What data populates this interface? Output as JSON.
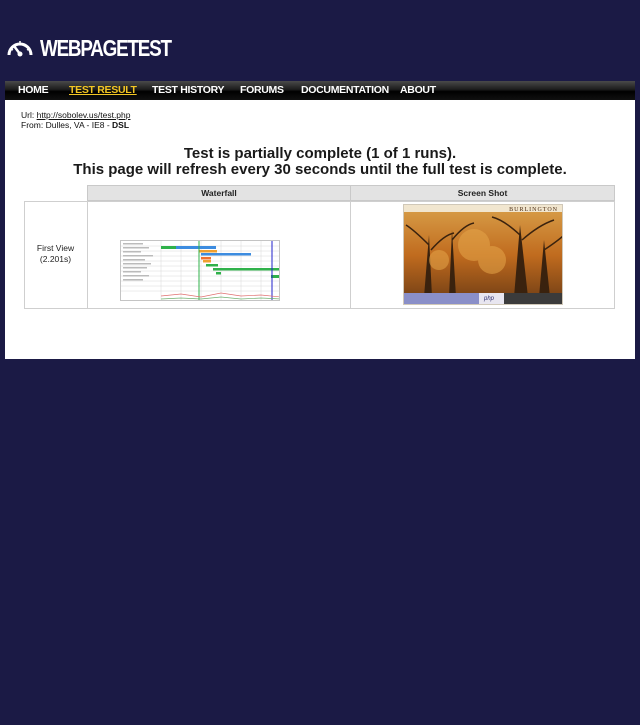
{
  "brand": {
    "bold": "WEB",
    "rest": "PAGETEST"
  },
  "nav": {
    "items": [
      {
        "label": "HOME",
        "active": false
      },
      {
        "label": "TEST RESULT",
        "active": true
      },
      {
        "label": "TEST HISTORY",
        "active": false
      },
      {
        "label": "FORUMS",
        "active": false
      },
      {
        "label": "DOCUMENTATION",
        "active": false
      },
      {
        "label": "ABOUT",
        "active": false
      }
    ]
  },
  "test": {
    "url_label": "Url:",
    "url": "http://sobolev.us/test.php",
    "from_label": "From:",
    "from_location": "Dulles, VA - IE8 -",
    "connection": "DSL"
  },
  "status": {
    "line1": "Test is partially complete (1 of 1 runs).",
    "line2": "This page will refresh every 30 seconds until the full test is complete."
  },
  "results": {
    "headers": {
      "waterfall": "Waterfall",
      "screenshot": "Screen Shot"
    },
    "row_label": "First View",
    "row_time": "(2.201s)"
  },
  "screenshot_thumb": {
    "brand": "BURLINGTON",
    "logo_text": "php"
  },
  "colors": {
    "page_bg": "#1b1a45",
    "nav_active": "#f3c623",
    "header_bg": "#e3e3e3"
  }
}
